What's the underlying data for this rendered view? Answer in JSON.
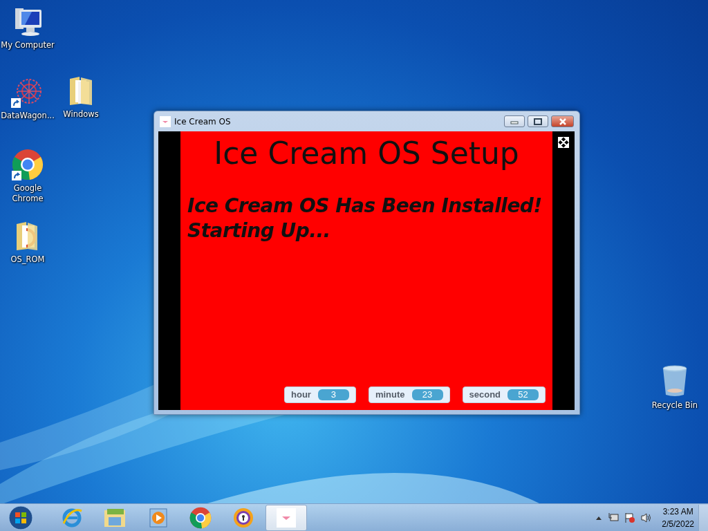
{
  "desktop_icons": [
    {
      "label": "My Computer",
      "kind": "computer",
      "shortcut": false
    },
    {
      "label": "DataWagon...",
      "kind": "network",
      "shortcut": true
    },
    {
      "label": "Windows",
      "kind": "folder",
      "shortcut": false
    },
    {
      "label": "Google Chrome",
      "kind": "chrome",
      "shortcut": true
    },
    {
      "label": "OS_ROM",
      "kind": "folder-doc",
      "shortcut": false
    },
    {
      "label": "Recycle Bin",
      "kind": "bin",
      "shortcut": false
    }
  ],
  "window": {
    "title": "Ice Cream OS",
    "heading": "Ice Cream OS Setup",
    "message": "Ice Cream OS Has Been Installed!\nStarting Up...",
    "monitors": [
      {
        "label": "hour",
        "value": "3"
      },
      {
        "label": "minute",
        "value": "23"
      },
      {
        "label": "second",
        "value": "52"
      }
    ]
  },
  "taskbar": {
    "items": [
      {
        "kind": "ie",
        "selected": false
      },
      {
        "kind": "explorer",
        "selected": false
      },
      {
        "kind": "media",
        "selected": false
      },
      {
        "kind": "chrome",
        "selected": false
      },
      {
        "kind": "vpn",
        "selected": false
      },
      {
        "kind": "icecream",
        "selected": true
      }
    ],
    "clock": {
      "time": "3:23 AM",
      "date": "2/5/2022"
    }
  }
}
